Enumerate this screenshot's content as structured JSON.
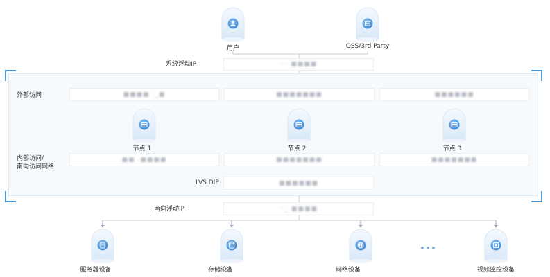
{
  "colors": {
    "accent": "#4a97d8",
    "line": "#c9ced6",
    "panel_bg": "#f7fafd",
    "bar_bg": "#ffffff"
  },
  "top": {
    "user_label": "用户",
    "oss_label": "OSS/3rd Party",
    "user_icon": "user-icon",
    "oss_icon": "cloud-storage-icon"
  },
  "rows": {
    "system_vip_label": "系统浮动IP",
    "external_label": "外部访问",
    "internal_label_line1": "内部访问/",
    "internal_label_line2": "南向访问网络",
    "lvs_label": "LVS DIP",
    "south_vip_label": "南向浮动IP"
  },
  "nodes": [
    {
      "label": "节点 1",
      "icon": "server-node-icon"
    },
    {
      "label": "节点 2",
      "icon": "server-node-icon"
    },
    {
      "label": "节点 3",
      "icon": "server-node-icon"
    }
  ],
  "devices": [
    {
      "label": "服务器设备",
      "icon": "server-icon"
    },
    {
      "label": "存储设备",
      "icon": "storage-icon"
    },
    {
      "label": "网络设备",
      "icon": "network-icon"
    },
    {
      "label": "视频监控设备",
      "icon": "video-surveillance-icon"
    }
  ],
  "masked": {
    "system_vip": "··· ■■■■",
    "ext1": "■■■■ ·_■",
    "ext2": "■■■■■■■",
    "ext3": "■■■■■■",
    "int1": "■■ ·■■■■",
    "int2": "■■■■■■■",
    "int3": "■■■■■■■",
    "lvs": "■■■■■■",
    "south_vip": "··_ ■■■■"
  }
}
